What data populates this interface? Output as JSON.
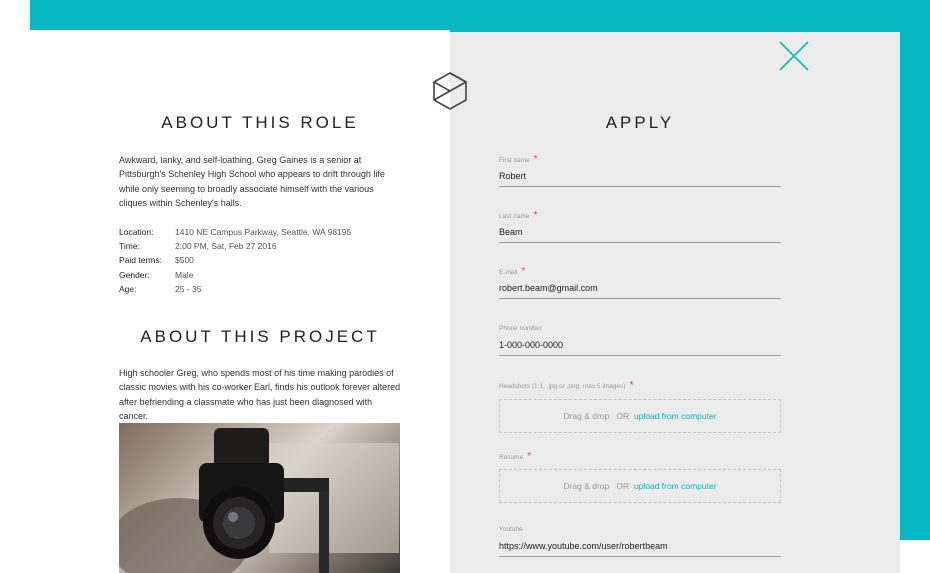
{
  "role": {
    "heading": "ABOUT THIS ROLE",
    "description": "Awkward, lanky, and self-loathing, Greg Gaines is a senior at Pittsburgh's Schenley High School who appears to drift through life while only seeming to broadly associate himself with the various cliques within Schenley's halls.",
    "details": [
      {
        "label": "Location:",
        "value": "1410 NE Campus Parkway, Seattle, WA 98195"
      },
      {
        "label": "Time:",
        "value": "2:00 PM, Sat, Feb 27 2016"
      },
      {
        "label": "Paid terms:",
        "value": "$500"
      },
      {
        "label": "Gender:",
        "value": "Male"
      },
      {
        "label": "Age:",
        "value": "25 - 35"
      }
    ]
  },
  "project": {
    "heading": "ABOUT THIS PROJECT",
    "description": "High schooler Greg, who spends most of his time making parodies of classic movies with his co-worker Earl, finds his outlook forever altered after befriending a classmate who has just been diagnosed with cancer."
  },
  "apply": {
    "heading": "APPLY",
    "required_mark": "*",
    "fields": [
      {
        "label": "First name",
        "value": "Robert",
        "required": true
      },
      {
        "label": "Last name",
        "value": "Beam",
        "required": true
      },
      {
        "label": "E-mail",
        "value": "robert.beam@gmail.com",
        "required": true
      },
      {
        "label": "Phone number",
        "value": "1-000-000-0000",
        "required": false
      }
    ],
    "headshots": {
      "label": "Headshots (1:1, .jpg or .png, max 5 images)",
      "drag_text": "Drag & drop",
      "or_text": "OR",
      "link_text": "upload from computer"
    },
    "resume": {
      "label": "Resume",
      "drag_text": "Drag & drop",
      "or_text": "OR",
      "link_text": "upload from computer"
    },
    "youtube": {
      "label": "Youtube",
      "value": "https://www.youtube.com/user/robertbeam"
    }
  },
  "icons": {
    "logo": "cube-logo-icon",
    "close": "close-icon",
    "camera": "camera-photo"
  },
  "colors": {
    "accent": "#06b8c1",
    "required": "#e0454a",
    "panel": "#ececec"
  }
}
